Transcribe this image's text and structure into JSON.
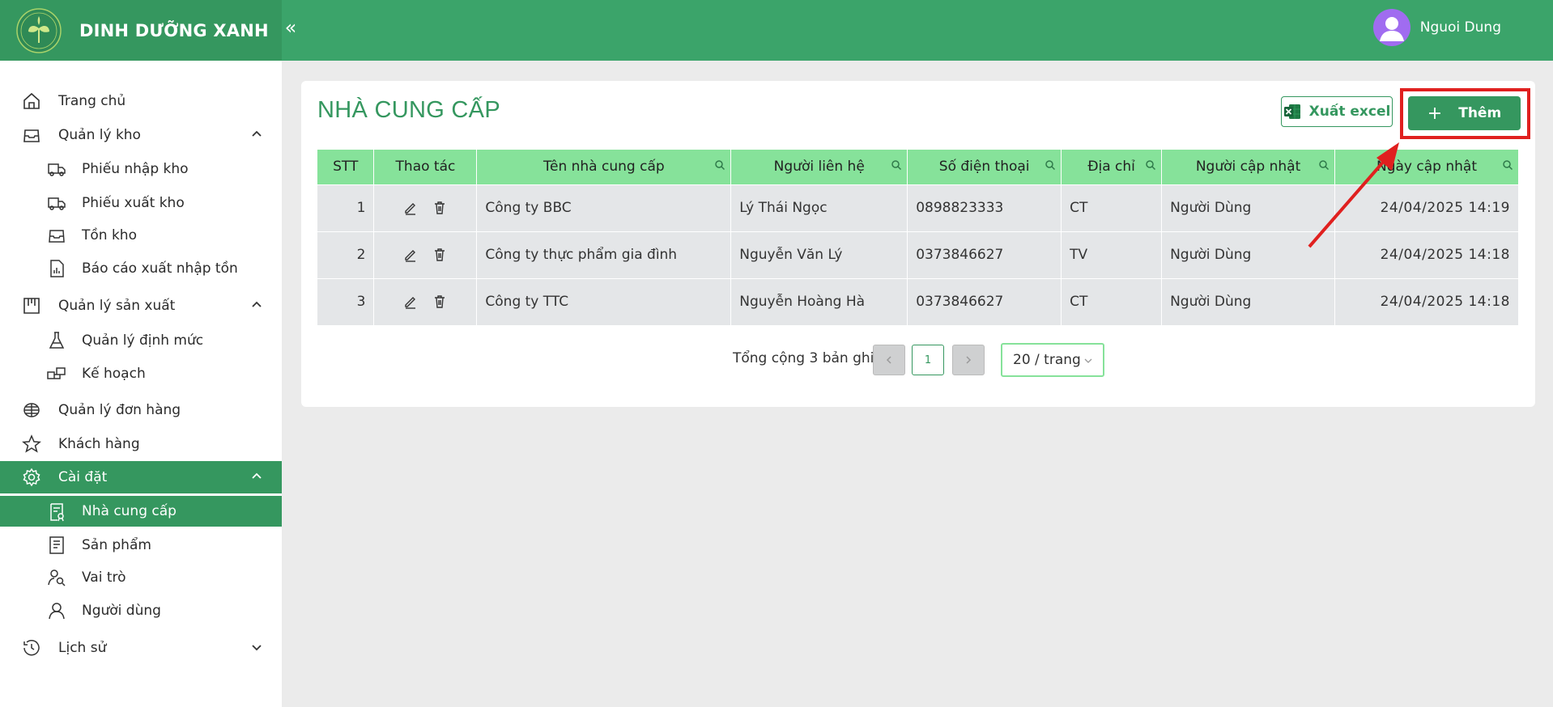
{
  "app": {
    "brand_name": "DINH DƯỠNG XANH",
    "collapse_glyph": "«",
    "user_name": "Nguoi Dung"
  },
  "sidebar": {
    "items": [
      {
        "label": "Trang chủ",
        "icon": "home-icon"
      },
      {
        "label": "Quản lý kho",
        "icon": "inbox-icon",
        "expanded": true
      },
      {
        "label": "Phiếu nhập kho",
        "icon": "truck-icon"
      },
      {
        "label": "Phiếu xuất kho",
        "icon": "delivery-truck-icon"
      },
      {
        "label": "Tồn kho",
        "icon": "inbox-icon"
      },
      {
        "label": "Báo cáo xuất nhập tồn",
        "icon": "report-icon"
      },
      {
        "label": "Quản lý sản xuất",
        "icon": "factory-icon",
        "expanded": true
      },
      {
        "label": "Quản lý định mức",
        "icon": "flask-icon"
      },
      {
        "label": "Kế hoạch",
        "icon": "blocks-icon"
      },
      {
        "label": "Quản lý đơn hàng",
        "icon": "order-icon"
      },
      {
        "label": "Khách hàng",
        "icon": "star-icon"
      },
      {
        "label": "Cài đặt",
        "icon": "gear-icon",
        "expanded": true
      },
      {
        "label": "Nhà cung cấp",
        "icon": "supplier-icon",
        "active": true
      },
      {
        "label": "Sản phẩm",
        "icon": "product-list-icon"
      },
      {
        "label": "Vai trò",
        "icon": "role-icon"
      },
      {
        "label": "Người dùng",
        "icon": "user-icon"
      },
      {
        "label": "Lịch sử",
        "icon": "clock-icon",
        "expanded": false
      }
    ]
  },
  "main": {
    "title": "NHÀ CUNG CẤP",
    "export_label": "Xuất excel",
    "add_label": "Thêm",
    "table": {
      "columns": [
        "STT",
        "Thao tác",
        "Tên nhà cung cấp",
        "Người liên hệ",
        "Số điện thoại",
        "Địa chỉ",
        "Người cập nhật",
        "Ngày cập nhật"
      ],
      "rows": [
        {
          "stt": "1",
          "name": "Công ty BBC",
          "contact": "Lý Thái Ngọc",
          "phone": "0898823333",
          "address": "CT",
          "updated_by": "Người Dùng",
          "updated_at": "24/04/2025 14:19"
        },
        {
          "stt": "2",
          "name": "Công ty thực phẩm gia đình",
          "contact": "Nguyễn Văn Lý",
          "phone": "0373846627",
          "address": "TV",
          "updated_by": "Người Dùng",
          "updated_at": "24/04/2025 14:18"
        },
        {
          "stt": "3",
          "name": "Công ty TTC",
          "contact": "Nguyễn Hoàng Hà",
          "phone": "0373846627",
          "address": "CT",
          "updated_by": "Người Dùng",
          "updated_at": "24/04/2025 14:18"
        }
      ]
    },
    "pagination": {
      "total_text": "Tổng cộng 3 bản ghi",
      "current_page": "1",
      "page_size": "20 / trang"
    }
  },
  "colors": {
    "header": "#3ba46a",
    "brand_bg": "#35975f",
    "table_header": "#86e29a",
    "annotation": "#e0201f"
  }
}
